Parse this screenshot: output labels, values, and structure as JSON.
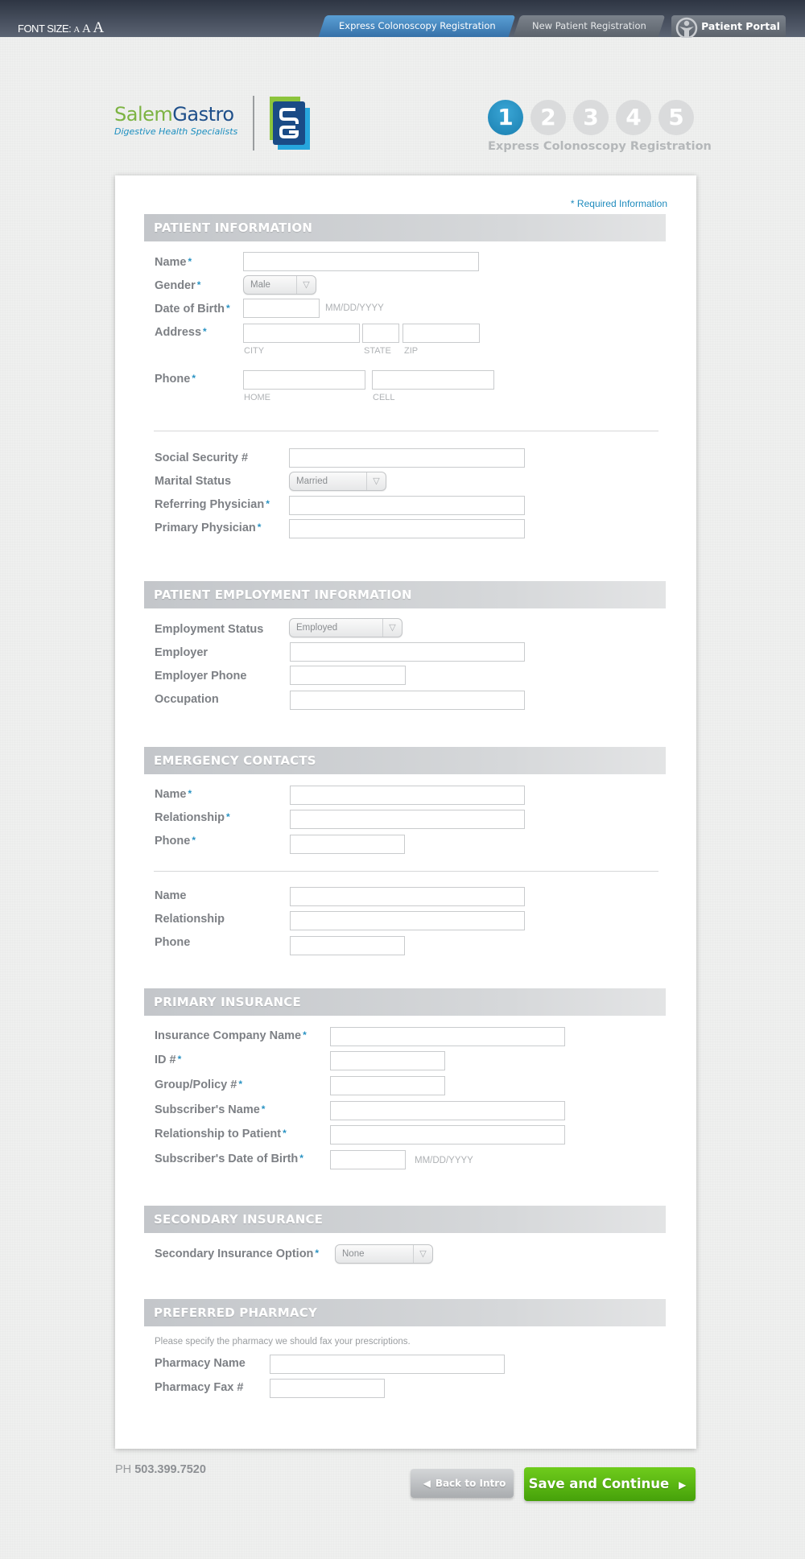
{
  "topbar": {
    "font_size_label": "FONT SIZE:",
    "font_size_options": [
      "A",
      "A",
      "A"
    ],
    "tabs": [
      {
        "label": "Express Colonoscopy Registration",
        "active": true
      },
      {
        "label": "New Patient Registration",
        "active": false
      },
      {
        "label": "Patient Portal",
        "icon": "portal-person-icon",
        "active": false
      }
    ]
  },
  "brand": {
    "name_part1": "Salem",
    "name_part2": "Gastro",
    "tagline": "Digestive Health Specialists",
    "colors": {
      "green": "#7cb342",
      "navy": "#1e4f8a",
      "blue": "#1d8fc0"
    }
  },
  "steps": {
    "items": [
      "1",
      "2",
      "3",
      "4",
      "5"
    ],
    "current": 1,
    "label": "Express Colonoscopy Registration"
  },
  "form": {
    "required_note": "* Required Information",
    "required_mark": "*",
    "patient_info": {
      "title": "PATIENT INFORMATION",
      "name_label": "Name",
      "gender_label": "Gender",
      "gender_value": "Male",
      "dob_label": "Date of Birth",
      "dob_hint": "MM/DD/YYYY",
      "address_label": "Address",
      "city_sub": "CITY",
      "state_sub": "STATE",
      "zip_sub": "ZIP",
      "phone_label": "Phone",
      "home_sub": "HOME",
      "cell_sub": "CELL",
      "ssn_label": "Social Security #",
      "marital_label": "Marital Status",
      "marital_value": "Married",
      "referring_label": "Referring Physician",
      "primary_label": "Primary Physician"
    },
    "employment": {
      "title": "PATIENT EMPLOYMENT INFORMATION",
      "status_label": "Employment Status",
      "status_value": "Employed",
      "employer_label": "Employer",
      "employer_phone_label": "Employer Phone",
      "occupation_label": "Occupation"
    },
    "emergency": {
      "title": "EMERGENCY CONTACTS",
      "name_label": "Name",
      "relationship_label": "Relationship",
      "phone_label": "Phone"
    },
    "primary_insurance": {
      "title": "PRIMARY INSURANCE",
      "company_label": "Insurance Company Name",
      "id_label": "ID #",
      "group_label": "Group/Policy #",
      "subscriber_name_label": "Subscriber's Name",
      "relationship_label": "Relationship to Patient",
      "subscriber_dob_label": "Subscriber's Date of Birth",
      "dob_hint": "MM/DD/YYYY"
    },
    "secondary_insurance": {
      "title": "SECONDARY INSURANCE",
      "option_label": "Secondary Insurance Option",
      "option_value": "None"
    },
    "pharmacy": {
      "title": "PREFERRED PHARMACY",
      "note": "Please specify the pharmacy we should fax your prescriptions.",
      "name_label": "Pharmacy Name",
      "fax_label": "Pharmacy Fax #"
    }
  },
  "footer": {
    "phone_prefix": "PH",
    "phone_number": "503.399.7520",
    "back_label": "Back to Intro",
    "save_label": "Save and Continue",
    "colors": {
      "save": "#5cb813",
      "accent": "#2a93c3"
    }
  }
}
